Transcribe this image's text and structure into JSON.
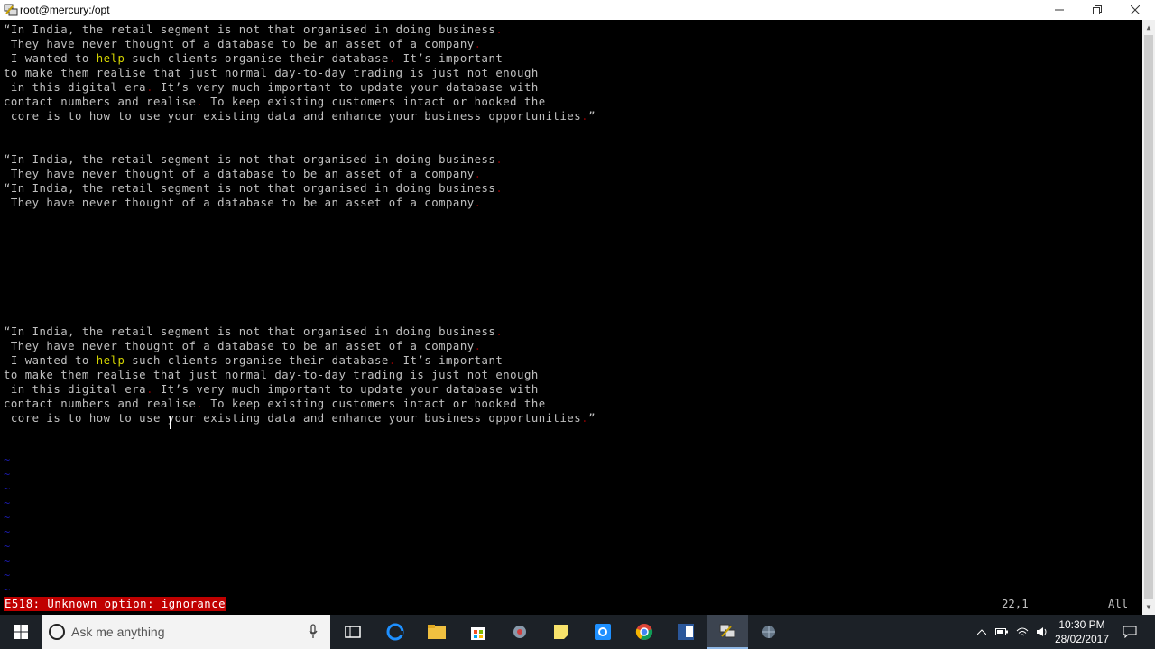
{
  "window": {
    "title": "root@mercury:/opt"
  },
  "editor": {
    "block1": [
      "“In India, the retail segment is not that organised in doing business.",
      " They have never thought of a database to be an asset of a company.",
      " I wanted to help such clients organise their database. It’s important",
      "to make them realise that just normal day-to-day trading is just not enough",
      " in this digital era. It’s very much important to update your database with",
      "contact numbers and realise. To keep existing customers intact or hooked the",
      " core is to how to use your existing data and enhance your business opportunities.”"
    ],
    "block2": [
      "“In India, the retail segment is not that organised in doing business.",
      " They have never thought of a database to be an asset of a company.",
      "“In India, the retail segment is not that organised in doing business.",
      " They have never thought of a database to be an asset of a company."
    ],
    "block3": [
      "“In India, the retail segment is not that organised in doing business.",
      " They have never thought of a database to be an asset of a company.",
      " I wanted to help such clients organise their database. It’s important",
      "to make them realise that just normal day-to-day trading is just not enough",
      " in this digital era. It’s very much important to update your database with",
      "contact numbers and realise. To keep existing customers intact or hooked the",
      " core is to how to use your existing data and enhance your business opportunities.”"
    ],
    "tilde": "~"
  },
  "statusline": {
    "error": "E518: Unknown option: ignorance",
    "position": "22,1",
    "scroll": "All"
  },
  "taskbar": {
    "search_placeholder": "Ask me anything",
    "time": "10:30 PM",
    "date": "28/02/2017"
  },
  "colors": {
    "terminal_bg": "#000000",
    "text": "#c0c0c0",
    "keyword": "#d4d400",
    "error_bg": "#c00000",
    "tilde": "#1a1aa6",
    "taskbar_bg": "#1c2127"
  }
}
